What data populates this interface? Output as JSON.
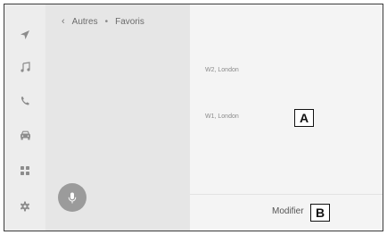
{
  "sidebar": {
    "items": [
      {
        "icon": "navigation-icon"
      },
      {
        "icon": "music-icon"
      },
      {
        "icon": "phone-icon"
      },
      {
        "icon": "car-icon"
      },
      {
        "icon": "apps-grid-icon"
      },
      {
        "icon": "settings-gear-icon"
      }
    ]
  },
  "header": {
    "back_label": "Autres",
    "separator": "•",
    "current_label": "Favoris"
  },
  "favorites": [
    {
      "label": "W2, London"
    },
    {
      "label": "W1, London"
    }
  ],
  "footer": {
    "modify_label": "Modifier"
  },
  "callouts": {
    "a": "A",
    "b": "B"
  },
  "colors": {
    "icon": "#8c8c8c",
    "mic_button": "#9b9b9b",
    "list_panel": "#e6e6e6",
    "detail_panel": "#f4f4f4"
  }
}
